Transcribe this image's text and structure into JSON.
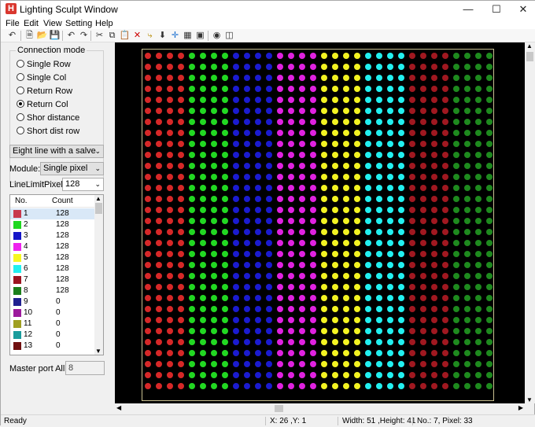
{
  "window": {
    "title": "Lighting Sculpt Window",
    "icon": "H"
  },
  "menu": [
    "File",
    "Edit",
    "View",
    "Setting",
    "Help"
  ],
  "connection_mode": {
    "title": "Connection mode",
    "options": [
      "Single Row",
      "Single Col",
      "Return Row",
      "Return Col",
      "Shor distance",
      "Short dist row"
    ],
    "selected": 3
  },
  "line_mode": {
    "value": "Eight line with a salve"
  },
  "module": {
    "label": "Module:",
    "value": "Single pixel"
  },
  "line_limit": {
    "label": "LineLimitPixels:",
    "value": "128"
  },
  "port_list": {
    "headers": [
      "No.",
      "Count"
    ],
    "rows": [
      {
        "no": "1",
        "count": "128",
        "color": "#c8384d"
      },
      {
        "no": "2",
        "count": "128",
        "color": "#1fd81f"
      },
      {
        "no": "3",
        "count": "128",
        "color": "#1616c8"
      },
      {
        "no": "4",
        "count": "128",
        "color": "#ee22ee"
      },
      {
        "no": "5",
        "count": "128",
        "color": "#f6f620"
      },
      {
        "no": "6",
        "count": "128",
        "color": "#22f0f0"
      },
      {
        "no": "7",
        "count": "128",
        "color": "#9c1520"
      },
      {
        "no": "8",
        "count": "128",
        "color": "#1b7f1b"
      },
      {
        "no": "9",
        "count": "0",
        "color": "#202090"
      },
      {
        "no": "10",
        "count": "0",
        "color": "#9c1a9c"
      },
      {
        "no": "11",
        "count": "0",
        "color": "#a0a022"
      },
      {
        "no": "12",
        "count": "0",
        "color": "#1a9c9c"
      },
      {
        "no": "13",
        "count": "0",
        "color": "#701010"
      }
    ]
  },
  "master_port": {
    "label": "Master port All:",
    "value": "8"
  },
  "canvas": {
    "columns": 8,
    "dots_per_column": 4,
    "colors": [
      "#d62828",
      "#22d822",
      "#1b1bd0",
      "#e022e0",
      "#f3f322",
      "#22f0f0",
      "#a01820",
      "#1e8a1e"
    ]
  },
  "status": {
    "state": "Ready",
    "coords": "X: 26 ,Y: 1",
    "size": "Width: 51 ,Height: 41",
    "pixel": "No.: 7, Pixel: 33"
  }
}
